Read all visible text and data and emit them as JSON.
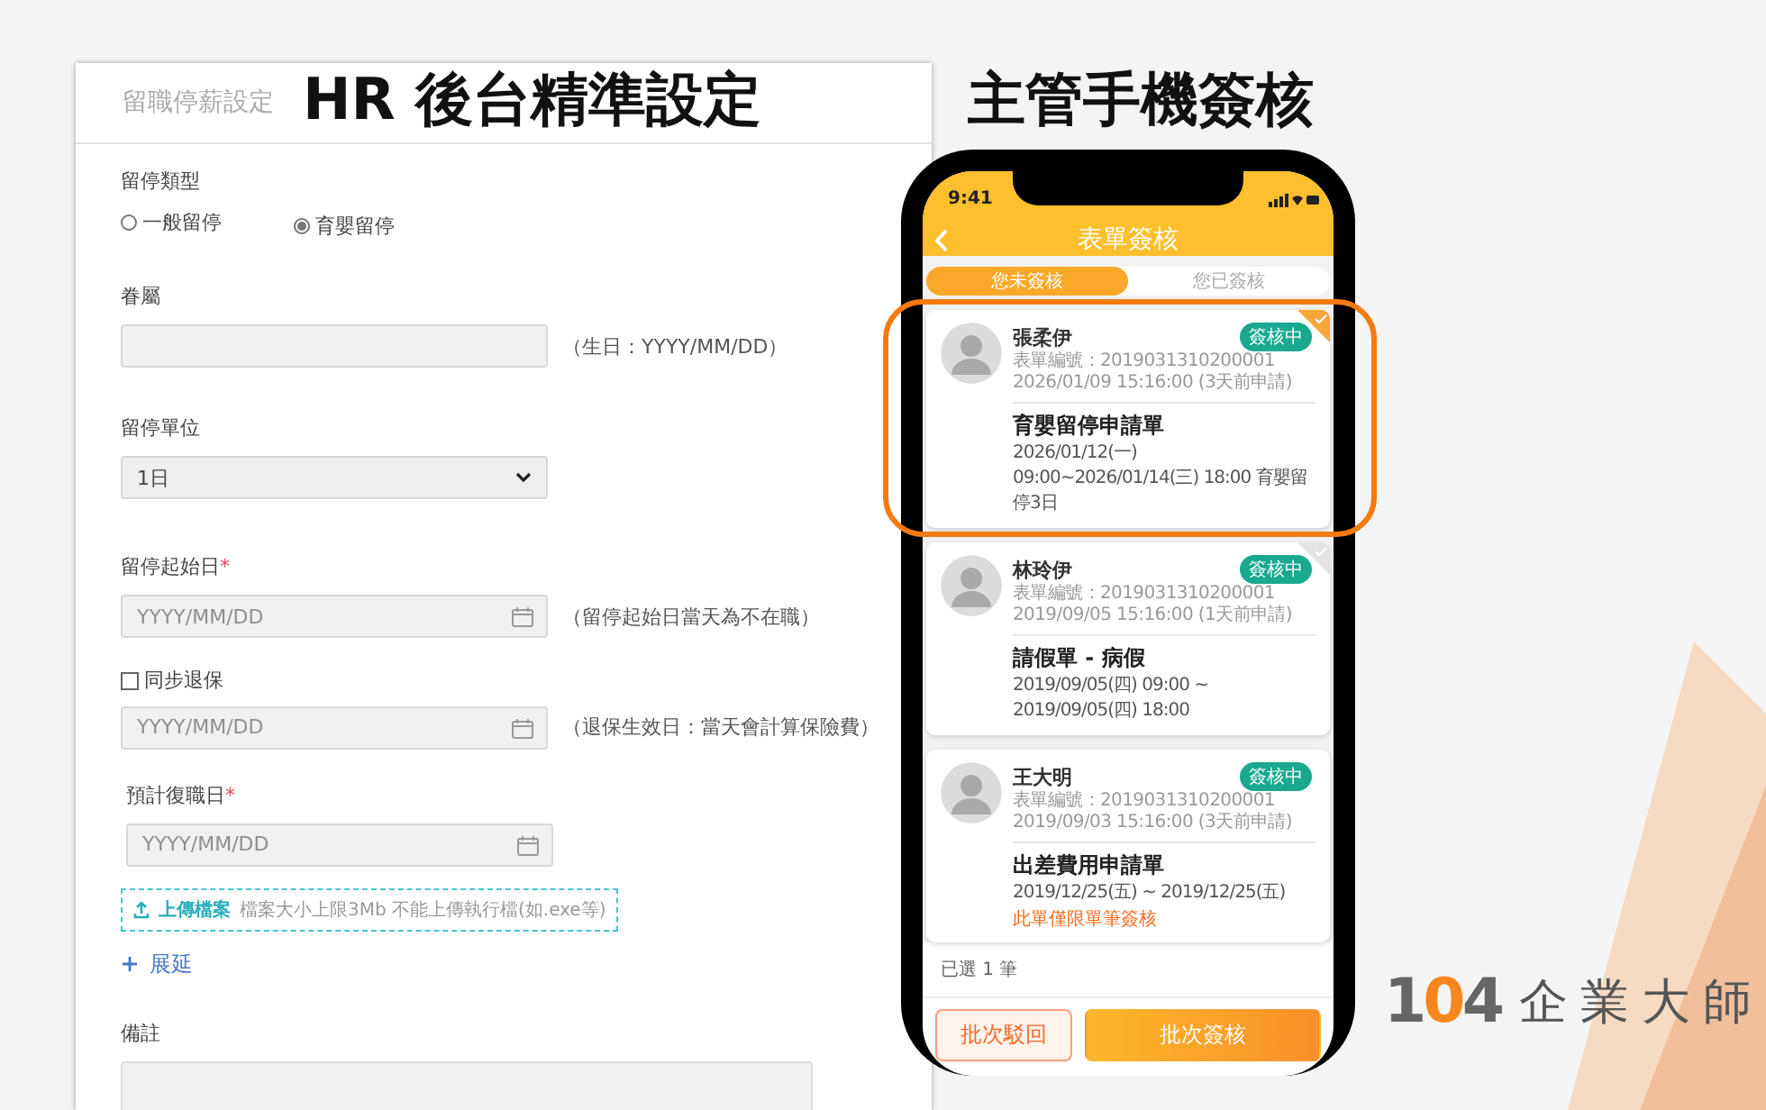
{
  "headlines": [
    "HR 後台精準設定",
    "主管手機簽核"
  ],
  "form": {
    "title": "留職停薪設定",
    "fields": [
      {
        "kind": "radio",
        "label": "留停類型",
        "options": [
          {
            "label": "一般留停",
            "selected": false
          },
          {
            "label": "育嬰留停",
            "selected": true
          }
        ]
      },
      {
        "kind": "text",
        "label": "眷屬",
        "hint": "（生日：YYYY/MM/DD）"
      },
      {
        "kind": "select",
        "label": "留停單位",
        "value": "1日"
      },
      {
        "kind": "date",
        "label": "留停起始日",
        "mark": "*",
        "placeholder": "YYYY/MM/DD",
        "hint": "（留停起始日當天為不在職）"
      },
      {
        "kind": "checkbox",
        "label": "同步退保",
        "checked": false
      },
      {
        "kind": "date",
        "placeholder": "YYYY/MM/DD",
        "hint": "（退保生效日：當天會計算保險費）"
      },
      {
        "kind": "date",
        "label": "預計復職日",
        "mark": "*",
        "placeholder": "YYYY/MM/DD"
      },
      {
        "kind": "upload",
        "label": "上傳檔案",
        "note": "檔案大小上限3Mb 不能上傳執行檔(如.exe等)"
      },
      {
        "kind": "link",
        "label": "展延"
      },
      {
        "kind": "textarea",
        "label": "備註"
      }
    ]
  },
  "phone": {
    "time": "9:41",
    "title": "表單簽核",
    "tabs": [
      {
        "label": "您未簽核",
        "selected": true
      },
      {
        "label": "您已簽核",
        "selected": false
      }
    ],
    "cards": [
      {
        "name": "張柔伊",
        "form_no": "表單編號：2019031310200001",
        "submitted": "2026/01/09 15:16:00 (3天前申請)",
        "status": "簽核中",
        "form_title": "育嬰留停申請單",
        "period": "2026/01/12(一) 09:00~2026/01/14(三) 18:00 育嬰留停3日",
        "checked": true,
        "highlighted": true
      },
      {
        "name": "林玲伊",
        "form_no": "表單編號：2019031310200001",
        "submitted": "2019/09/05 15:16:00 (1天前申請)",
        "status": "簽核中",
        "form_title": "請假單 - 病假",
        "period": "2019/09/05(四) 09:00 ~ 2019/09/05(四) 18:00",
        "checked": false,
        "highlighted": false
      },
      {
        "name": "王大明",
        "form_no": "表單編號：2019031310200001",
        "submitted": "2019/09/03 15:16:00 (3天前申請)",
        "status": "簽核中",
        "form_title": "出差費用申請單",
        "period": "2019/12/25(五) ~ 2019/12/25(五)",
        "note": "此單僅限單筆簽核",
        "highlighted": false
      }
    ],
    "selected_count": "已選 1 筆",
    "buttons": [
      {
        "kind": "secondary",
        "label": "批次駁回"
      },
      {
        "kind": "primary",
        "label": "批次簽核"
      }
    ]
  },
  "logo": {
    "number": "104",
    "name": "企業大師"
  }
}
